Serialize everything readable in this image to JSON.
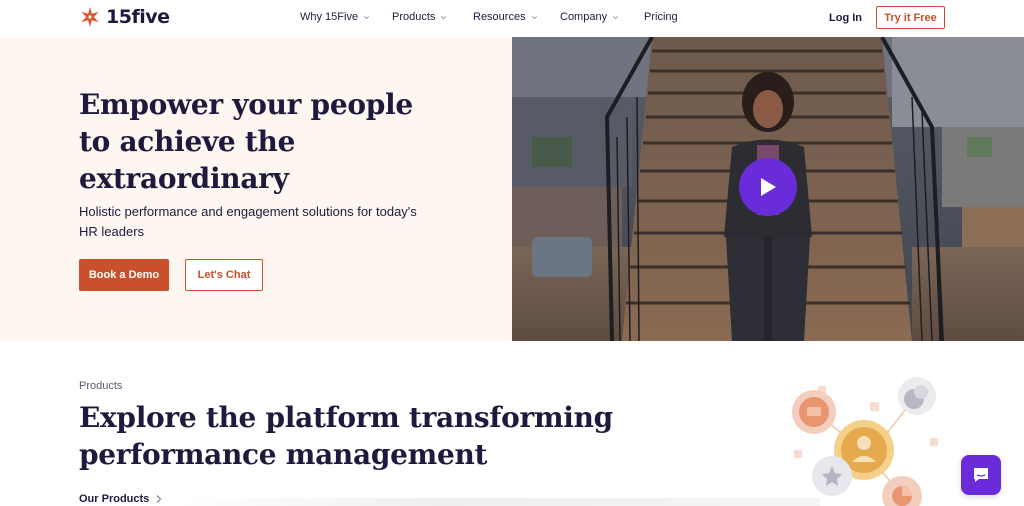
{
  "brand": {
    "name": "15five",
    "accent": "#c9502a",
    "purple": "#6a2bd9",
    "navy": "#1f1a3d",
    "hero_bg": "#fdf6f1"
  },
  "nav": {
    "items": [
      {
        "label": "Why 15Five",
        "dropdown": true
      },
      {
        "label": "Products",
        "dropdown": true
      },
      {
        "label": "Resources",
        "dropdown": true
      },
      {
        "label": "Company",
        "dropdown": true
      },
      {
        "label": "Pricing",
        "dropdown": false
      }
    ],
    "login_label": "Log In",
    "try_label": "Try it Free"
  },
  "hero": {
    "title": "Empower your people to achieve the extraordinary",
    "subtitle": "Holistic performance and engagement solutions for today's HR leaders",
    "demo_label": "Book a Demo",
    "chat_label": "Let's Chat",
    "video_icon": "play-icon"
  },
  "products": {
    "eyebrow": "Products",
    "title": "Explore the platform transforming performance management",
    "link_label": "Our Products"
  },
  "chat_widget_icon": "chat-bubble-icon"
}
